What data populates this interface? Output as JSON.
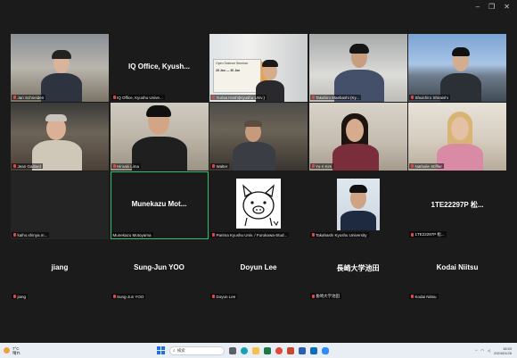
{
  "window": {
    "controls": [
      "–",
      "❐",
      "✕"
    ]
  },
  "participants": [
    {
      "name": "Jan Schneiden",
      "muted": true
    },
    {
      "name": "IQ Office, Kyushu Unive...",
      "display": "IQ Office, Kyush...",
      "muted": true
    },
    {
      "name": "Yurisa Hoshi(Kyushu Univ.)",
      "muted": true
    },
    {
      "name": "Takahiro Maebashi (Ky...",
      "muted": true
    },
    {
      "name": "Shuichiro Shiraishi",
      "muted": true
    },
    {
      "name": "Jean Gaillard",
      "muted": true
    },
    {
      "name": "Hiroaki Lima",
      "muted": true
    },
    {
      "name": "Walter",
      "muted": true
    },
    {
      "name": "Yu-ri Kim",
      "muted": true
    },
    {
      "name": "Nathalie Stiffler",
      "muted": true
    },
    {
      "name": "kaiho.shinya.m...",
      "muted": true
    },
    {
      "name": "Munekazu Motoyama",
      "display": "Munekazu Mot...",
      "muted": false
    },
    {
      "name": "Parima Kyushu Univ. / Furukawa-Stud...",
      "muted": true
    },
    {
      "name": "Takahashi Kyushu University",
      "muted": true
    },
    {
      "name": "1TE22297P 松...",
      "display": "1TE22297P 松...",
      "muted": true
    },
    {
      "name": "jiang",
      "display": "jiang",
      "muted": true
    },
    {
      "name": "Sung-Jun YOO",
      "display": "Sung-Jun YOO",
      "muted": true
    },
    {
      "name": "Doyun Lee",
      "display": "Doyun Lee",
      "muted": true
    },
    {
      "name": "長崎大学池田",
      "display": "長崎大学池田",
      "muted": true
    },
    {
      "name": "Kodai Niitsu",
      "display": "Kodai Niitsu",
      "muted": true
    }
  ],
  "slide": {
    "lines": [
      "Open Science Seminar",
      "26 Jan — 30 Jan"
    ]
  },
  "taskbar": {
    "weather": "7°C",
    "weather_sub": "晴れ",
    "search_placeholder": "検索",
    "time": "16:53",
    "date": "2024/01/26",
    "accent": "#1e6fd9"
  }
}
